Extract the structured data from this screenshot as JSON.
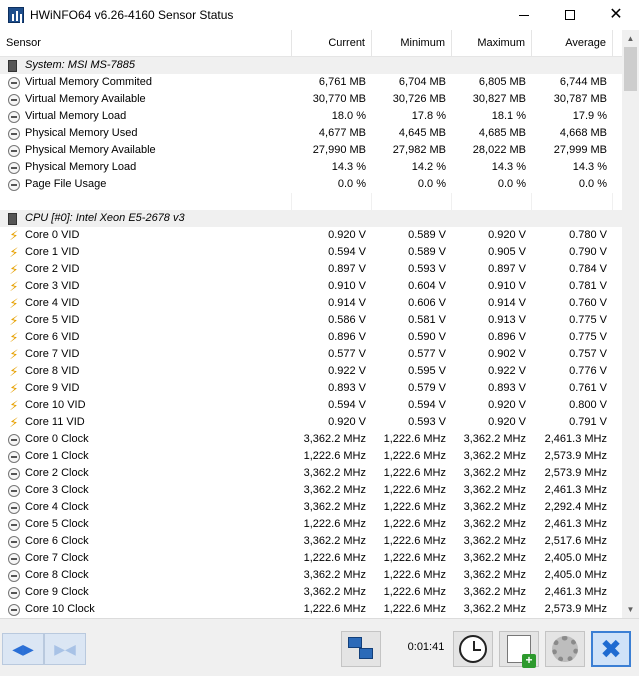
{
  "window": {
    "title": "HWiNFO64 v6.26-4160 Sensor Status"
  },
  "columns": [
    "Sensor",
    "Current",
    "Minimum",
    "Maximum",
    "Average"
  ],
  "sections": [
    {
      "group": "System: MSI MS-7885",
      "rows": [
        {
          "icon": "gauge-icon",
          "name": "Virtual Memory Commited",
          "cur": "6,761 MB",
          "min": "6,704 MB",
          "max": "6,805 MB",
          "avg": "6,744 MB"
        },
        {
          "icon": "gauge-icon",
          "name": "Virtual Memory Available",
          "cur": "30,770 MB",
          "min": "30,726 MB",
          "max": "30,827 MB",
          "avg": "30,787 MB"
        },
        {
          "icon": "gauge-icon",
          "name": "Virtual Memory Load",
          "cur": "18.0 %",
          "min": "17.8 %",
          "max": "18.1 %",
          "avg": "17.9 %"
        },
        {
          "icon": "gauge-icon",
          "name": "Physical Memory Used",
          "cur": "4,677 MB",
          "min": "4,645 MB",
          "max": "4,685 MB",
          "avg": "4,668 MB"
        },
        {
          "icon": "gauge-icon",
          "name": "Physical Memory Available",
          "cur": "27,990 MB",
          "min": "27,982 MB",
          "max": "28,022 MB",
          "avg": "27,999 MB"
        },
        {
          "icon": "gauge-icon",
          "name": "Physical Memory Load",
          "cur": "14.3 %",
          "min": "14.2 %",
          "max": "14.3 %",
          "avg": "14.3 %"
        },
        {
          "icon": "gauge-icon",
          "name": "Page File Usage",
          "cur": "0.0 %",
          "min": "0.0 %",
          "max": "0.0 %",
          "avg": "0.0 %"
        }
      ]
    },
    {
      "group": "CPU [#0]: Intel Xeon E5-2678 v3",
      "rows": [
        {
          "icon": "voltage-icon",
          "name": "Core 0 VID",
          "cur": "0.920 V",
          "min": "0.589 V",
          "max": "0.920 V",
          "avg": "0.780 V"
        },
        {
          "icon": "voltage-icon",
          "name": "Core 1 VID",
          "cur": "0.594 V",
          "min": "0.589 V",
          "max": "0.905 V",
          "avg": "0.790 V"
        },
        {
          "icon": "voltage-icon",
          "name": "Core 2 VID",
          "cur": "0.897 V",
          "min": "0.593 V",
          "max": "0.897 V",
          "avg": "0.784 V"
        },
        {
          "icon": "voltage-icon",
          "name": "Core 3 VID",
          "cur": "0.910 V",
          "min": "0.604 V",
          "max": "0.910 V",
          "avg": "0.781 V"
        },
        {
          "icon": "voltage-icon",
          "name": "Core 4 VID",
          "cur": "0.914 V",
          "min": "0.606 V",
          "max": "0.914 V",
          "avg": "0.760 V"
        },
        {
          "icon": "voltage-icon",
          "name": "Core 5 VID",
          "cur": "0.586 V",
          "min": "0.581 V",
          "max": "0.913 V",
          "avg": "0.775 V"
        },
        {
          "icon": "voltage-icon",
          "name": "Core 6 VID",
          "cur": "0.896 V",
          "min": "0.590 V",
          "max": "0.896 V",
          "avg": "0.775 V"
        },
        {
          "icon": "voltage-icon",
          "name": "Core 7 VID",
          "cur": "0.577 V",
          "min": "0.577 V",
          "max": "0.902 V",
          "avg": "0.757 V"
        },
        {
          "icon": "voltage-icon",
          "name": "Core 8 VID",
          "cur": "0.922 V",
          "min": "0.595 V",
          "max": "0.922 V",
          "avg": "0.776 V"
        },
        {
          "icon": "voltage-icon",
          "name": "Core 9 VID",
          "cur": "0.893 V",
          "min": "0.579 V",
          "max": "0.893 V",
          "avg": "0.761 V"
        },
        {
          "icon": "voltage-icon",
          "name": "Core 10 VID",
          "cur": "0.594 V",
          "min": "0.594 V",
          "max": "0.920 V",
          "avg": "0.800 V"
        },
        {
          "icon": "voltage-icon",
          "name": "Core 11 VID",
          "cur": "0.920 V",
          "min": "0.593 V",
          "max": "0.920 V",
          "avg": "0.791 V"
        },
        {
          "icon": "gauge-icon",
          "name": "Core 0 Clock",
          "cur": "3,362.2 MHz",
          "min": "1,222.6 MHz",
          "max": "3,362.2 MHz",
          "avg": "2,461.3 MHz"
        },
        {
          "icon": "gauge-icon",
          "name": "Core 1 Clock",
          "cur": "1,222.6 MHz",
          "min": "1,222.6 MHz",
          "max": "3,362.2 MHz",
          "avg": "2,573.9 MHz"
        },
        {
          "icon": "gauge-icon",
          "name": "Core 2 Clock",
          "cur": "3,362.2 MHz",
          "min": "1,222.6 MHz",
          "max": "3,362.2 MHz",
          "avg": "2,573.9 MHz"
        },
        {
          "icon": "gauge-icon",
          "name": "Core 3 Clock",
          "cur": "3,362.2 MHz",
          "min": "1,222.6 MHz",
          "max": "3,362.2 MHz",
          "avg": "2,461.3 MHz"
        },
        {
          "icon": "gauge-icon",
          "name": "Core 4 Clock",
          "cur": "3,362.2 MHz",
          "min": "1,222.6 MHz",
          "max": "3,362.2 MHz",
          "avg": "2,292.4 MHz"
        },
        {
          "icon": "gauge-icon",
          "name": "Core 5 Clock",
          "cur": "1,222.6 MHz",
          "min": "1,222.6 MHz",
          "max": "3,362.2 MHz",
          "avg": "2,461.3 MHz"
        },
        {
          "icon": "gauge-icon",
          "name": "Core 6 Clock",
          "cur": "3,362.2 MHz",
          "min": "1,222.6 MHz",
          "max": "3,362.2 MHz",
          "avg": "2,517.6 MHz"
        },
        {
          "icon": "gauge-icon",
          "name": "Core 7 Clock",
          "cur": "1,222.6 MHz",
          "min": "1,222.6 MHz",
          "max": "3,362.2 MHz",
          "avg": "2,405.0 MHz"
        },
        {
          "icon": "gauge-icon",
          "name": "Core 8 Clock",
          "cur": "3,362.2 MHz",
          "min": "1,222.6 MHz",
          "max": "3,362.2 MHz",
          "avg": "2,405.0 MHz"
        },
        {
          "icon": "gauge-icon",
          "name": "Core 9 Clock",
          "cur": "3,362.2 MHz",
          "min": "1,222.6 MHz",
          "max": "3,362.2 MHz",
          "avg": "2,461.3 MHz"
        },
        {
          "icon": "gauge-icon",
          "name": "Core 10 Clock",
          "cur": "1,222.6 MHz",
          "min": "1,222.6 MHz",
          "max": "3,362.2 MHz",
          "avg": "2,573.9 MHz"
        }
      ]
    }
  ],
  "toolbar": {
    "timer": "0:01:41",
    "icons": [
      "nav-back-icon",
      "nav-forward-icon",
      "network-icon",
      "clock-icon",
      "add-report-icon",
      "settings-gear-icon",
      "close-x-icon"
    ]
  }
}
